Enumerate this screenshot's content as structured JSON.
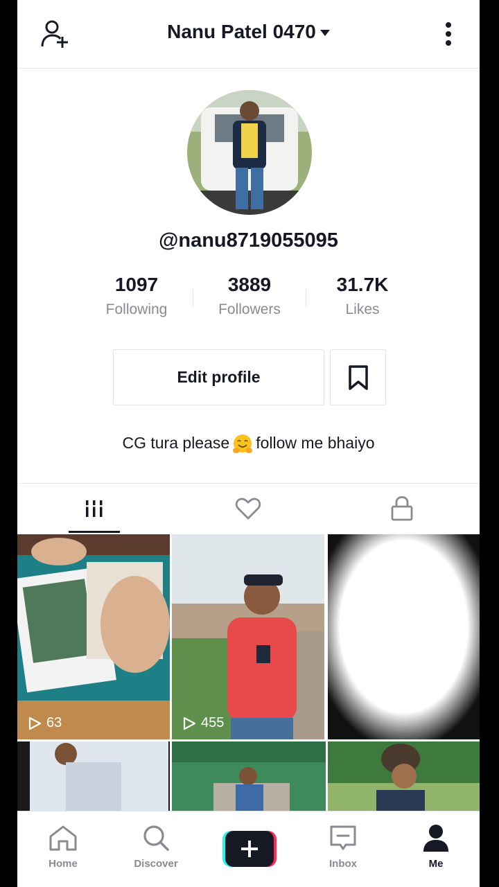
{
  "header": {
    "title": "Nanu Patel 0470"
  },
  "profile": {
    "handle": "@nanu8719055095",
    "stats": [
      {
        "value": "1097",
        "label": "Following"
      },
      {
        "value": "3889",
        "label": "Followers"
      },
      {
        "value": "31.7K",
        "label": "Likes"
      }
    ],
    "edit_label": "Edit profile",
    "bio_before": "CG tura please",
    "bio_after": "follow me bhaiyo"
  },
  "videos": [
    {
      "views": "63"
    },
    {
      "views": "455"
    },
    {
      "views": ""
    }
  ],
  "nav": {
    "home": "Home",
    "discover": "Discover",
    "inbox": "Inbox",
    "me": "Me"
  },
  "colors": {
    "accent_cyan": "#25f4ee",
    "accent_red": "#fe2c55",
    "text": "#161823",
    "muted": "#8a8b91"
  }
}
